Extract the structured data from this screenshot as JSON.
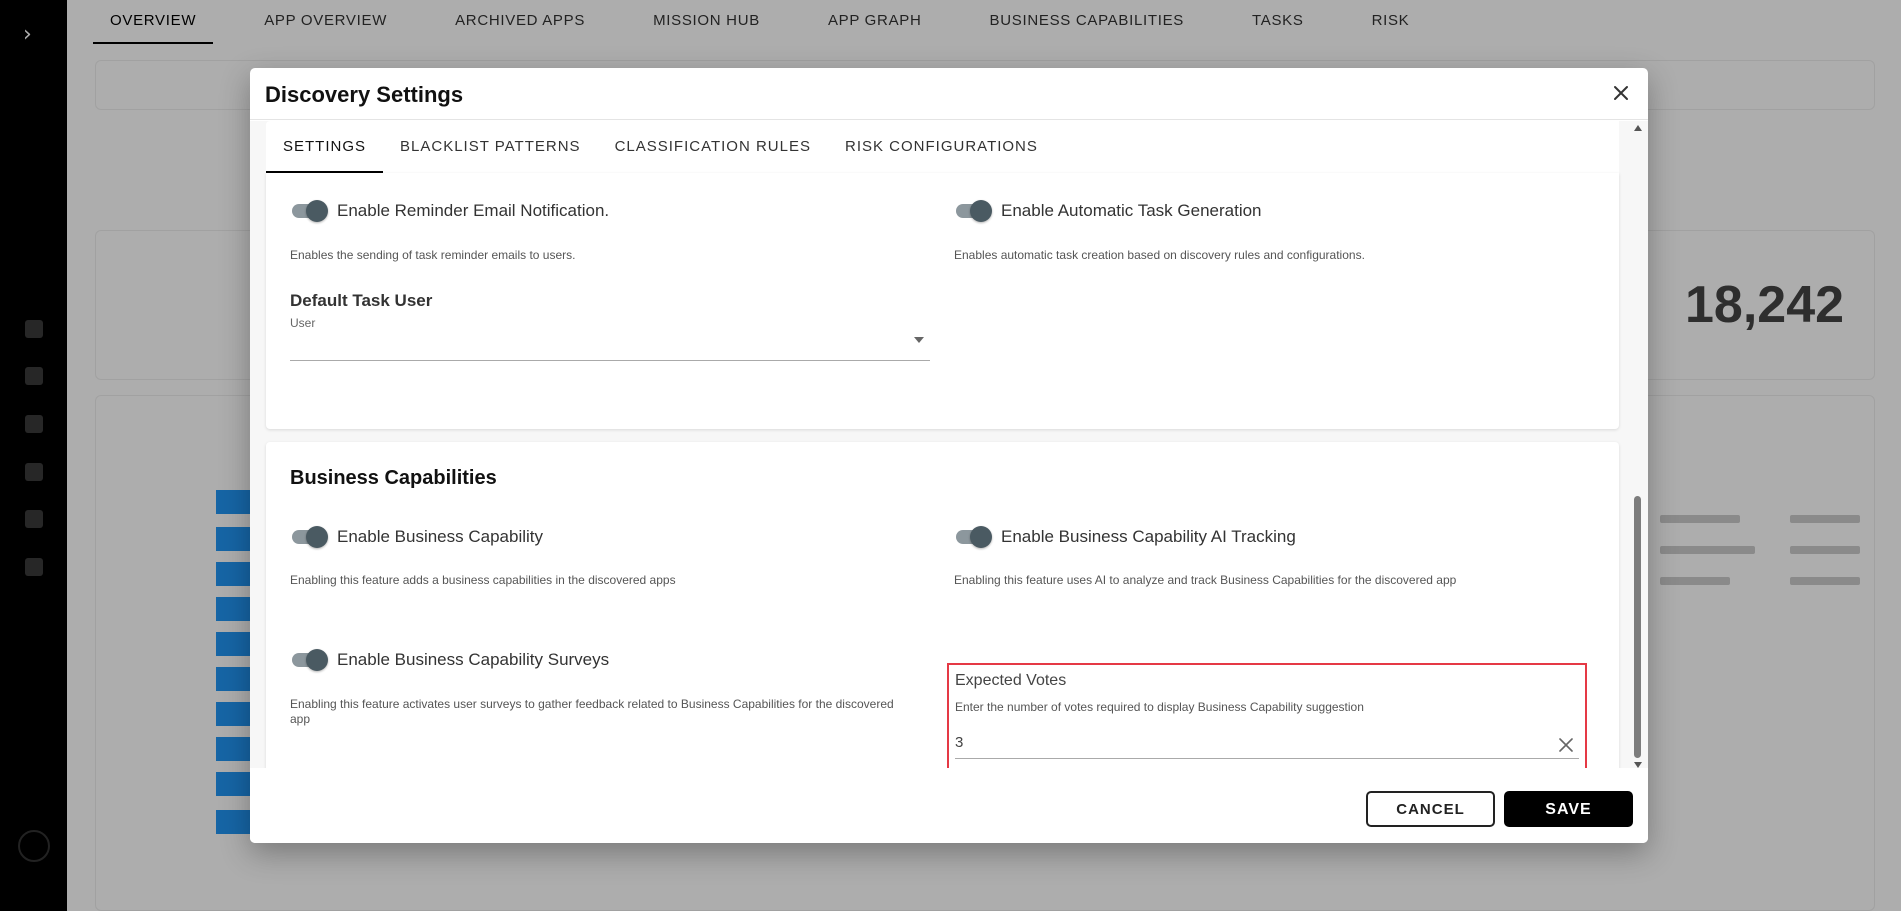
{
  "background": {
    "tabs": [
      "OVERVIEW",
      "APP OVERVIEW",
      "ARCHIVED APPS",
      "MISSION HUB",
      "APP GRAPH",
      "BUSINESS CAPABILITIES",
      "TASKS",
      "RISK"
    ],
    "stat_value": "18,242"
  },
  "modal": {
    "title": "Discovery Settings",
    "tabs": [
      "SETTINGS",
      "BLACKLIST PATTERNS",
      "CLASSIFICATION RULES",
      "RISK CONFIGURATIONS"
    ],
    "active_tab": "SETTINGS",
    "tasks_section": {
      "reminder_toggle": {
        "label": "Enable Reminder Email Notification.",
        "help": "Enables the sending of task reminder emails to users.",
        "on": true
      },
      "auto_task_toggle": {
        "label": "Enable Automatic Task Generation",
        "help": "Enables automatic task creation based on discovery rules and configurations.",
        "on": true
      },
      "default_task_user": {
        "title": "Default Task User",
        "label": "User",
        "value": ""
      }
    },
    "business_capabilities": {
      "title": "Business Capabilities",
      "capability_toggle": {
        "label": "Enable Business Capability",
        "help": "Enabling this feature adds a business capabilities in the discovered apps",
        "on": true
      },
      "ai_tracking_toggle": {
        "label": "Enable Business Capability AI Tracking",
        "help": "Enabling this feature uses AI to analyze and track Business Capabilities for the discovered app",
        "on": true
      },
      "surveys_toggle": {
        "label": "Enable Business Capability Surveys",
        "help_line1": "Enabling this feature activates user surveys to gather feedback related to Business Capabilities for the discovered",
        "help_line2": "app",
        "on": true
      },
      "expected_votes": {
        "title": "Expected Votes",
        "help": "Enter the number of votes required to display Business Capability suggestion",
        "value": "3"
      }
    },
    "footer": {
      "cancel_label": "CANCEL",
      "save_label": "SAVE"
    }
  },
  "colors": {
    "highlight_border": "#e53945",
    "toggle_thumb": "#4a5a62",
    "save_bg": "#000000"
  }
}
